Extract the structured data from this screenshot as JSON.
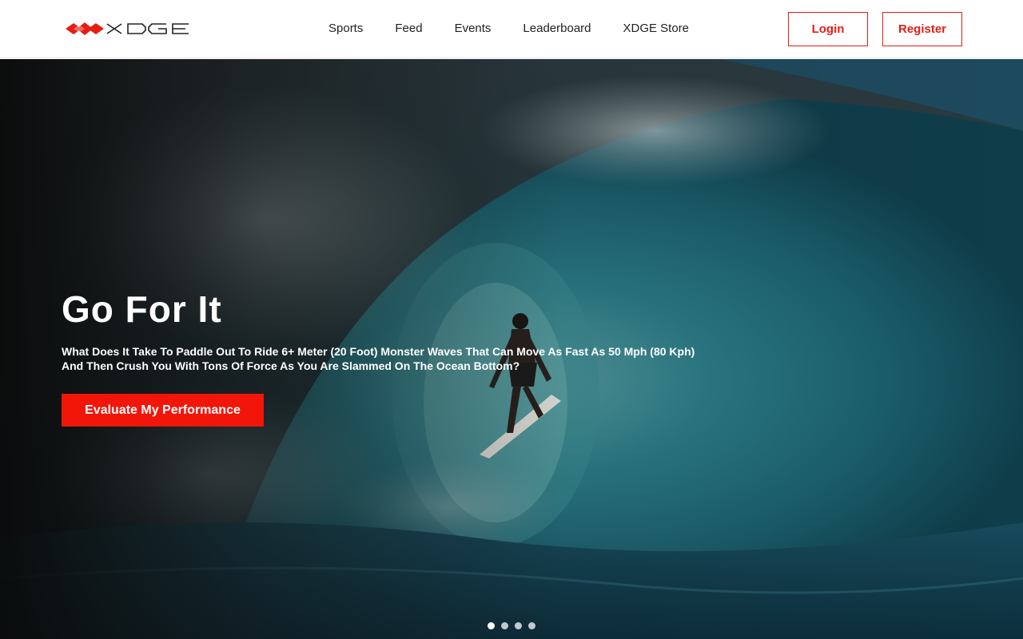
{
  "brand": {
    "logo_text": "XDGE",
    "logo_color": "#e41e13"
  },
  "nav": {
    "items": [
      {
        "label": "Sports"
      },
      {
        "label": "Feed"
      },
      {
        "label": "Events"
      },
      {
        "label": "Leaderboard"
      },
      {
        "label": "XDGE Store"
      }
    ]
  },
  "auth": {
    "login_label": "Login",
    "register_label": "Register"
  },
  "hero": {
    "title": "Go For It",
    "subtitle": "What Does It Take To Paddle Out To Ride 6+ Meter (20 Foot) Monster Waves That Can Move As Fast As 50 Mph (80 Kph) And Then Crush You With Tons Of Force As You Are Slammed On The Ocean Bottom?",
    "cta_label": "Evaluate My Performance",
    "image_subject": "surfer-in-barrel-wave",
    "carousel": {
      "slide_count": 4,
      "active_index": 0
    }
  },
  "colors": {
    "accent": "#e41e13",
    "cta": "#f2150a"
  }
}
